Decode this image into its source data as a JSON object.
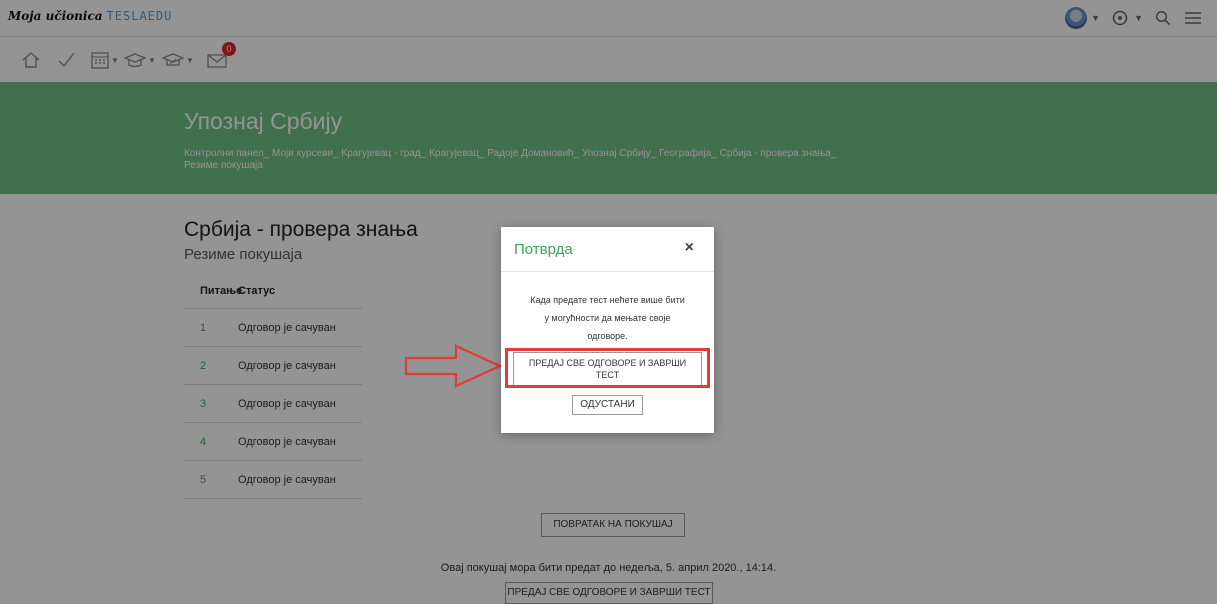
{
  "topbar": {
    "logo_script": "Moja učionica",
    "logo_brand": "TESLAEDU"
  },
  "hero": {
    "title": "Упознај Србију",
    "breadcrumbs": [
      "Контролни панел",
      "Моји курсеви",
      "Крагујевац - град",
      "Крагујевац",
      "Радоје Домановић",
      "Упознај Србију",
      "Географија",
      "Србија - провера знања",
      "Резиме покушаја"
    ]
  },
  "content": {
    "title": "Србија - провера знања",
    "subtitle": "Резиме покушаја",
    "table": {
      "headers": [
        "Питање",
        "Статус"
      ],
      "rows": [
        {
          "num": "1",
          "status": "Одговор је сачуван"
        },
        {
          "num": "2",
          "status": "Одговор је сачуван"
        },
        {
          "num": "3",
          "status": "Одговор је сачуван"
        },
        {
          "num": "4",
          "status": "Одговор је сачуван"
        },
        {
          "num": "5",
          "status": "Одговор је сачуван"
        }
      ]
    },
    "return_button": "ПОВРАТАК НА ПОКУШАЈ",
    "deadline": "Овај покушај мора бити предат до недеља, 5. април 2020., 14:14.",
    "submit_button": "ПРЕДАЈ СВЕ ОДГОВОРЕ И ЗАВРШИ ТЕСТ"
  },
  "modal": {
    "title": "Потврда",
    "close": "×",
    "message_lines": [
      "Када предате тест нећете више бити",
      "у могућности да мењате своје",
      "одговоре."
    ],
    "confirm_line1": "ПРЕДАЈ СВЕ ОДГОВОРЕ И ЗАВРШИ",
    "confirm_line2": "ТЕСТ",
    "cancel": "ОДУСТАНИ"
  },
  "notifications": {
    "badge_count": "0"
  },
  "colors": {
    "green": "#6fc184",
    "accent_green": "#3aa55a",
    "highlight_red": "#e33a3a",
    "badge_red": "#e32626"
  }
}
